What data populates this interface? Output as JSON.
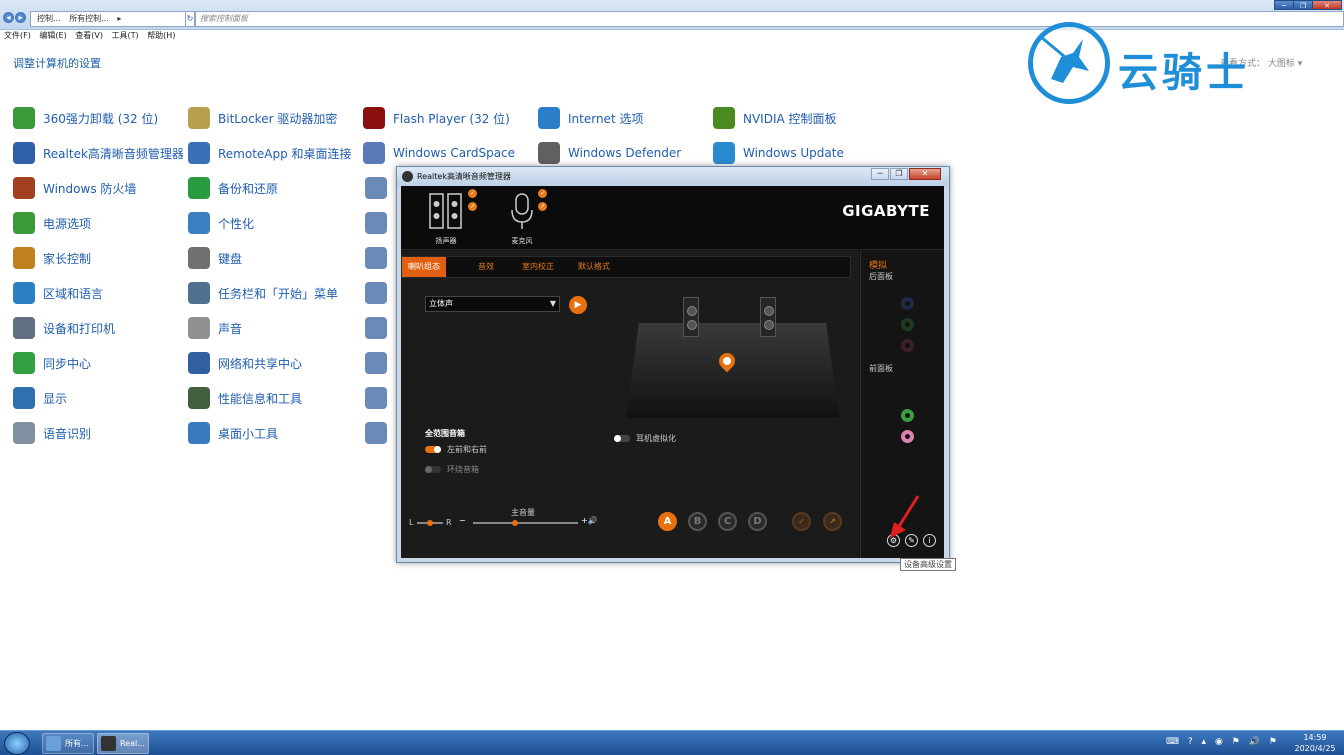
{
  "explorer": {
    "address": [
      "控制...",
      "所有控制...",
      "▸"
    ],
    "search_placeholder": "搜索控制面板",
    "menu": [
      "文件(F)",
      "编辑(E)",
      "查看(V)",
      "工具(T)",
      "帮助(H)"
    ],
    "heading": "调整计算机的设置",
    "view_options": "查看方式：  大图标 ▾",
    "window_controls": [
      "─",
      "❐",
      "✕"
    ]
  },
  "watermark": {
    "text": "云骑士"
  },
  "control_panel": {
    "items": [
      {
        "label": "360强力卸载 (32 位)",
        "icon": "uninstall-icon",
        "color": "#3a9a3a"
      },
      {
        "label": "BitLocker 驱动器加密",
        "icon": "bitlocker-key-icon",
        "color": "#b8a050"
      },
      {
        "label": "Flash Player (32 位)",
        "icon": "flash-icon",
        "color": "#8a1010"
      },
      {
        "label": "Internet 选项",
        "icon": "internet-globe-icon",
        "color": "#2a7fc8"
      },
      {
        "label": "NVIDIA 控制面板",
        "icon": "nvidia-icon",
        "color": "#4a8a20"
      },
      {
        "label": "Realtek高清晰音频管理器",
        "icon": "realtek-audio-icon",
        "color": "#2f5fa8"
      },
      {
        "label": "RemoteApp 和桌面连接",
        "icon": "remoteapp-icon",
        "color": "#3a70b8"
      },
      {
        "label": "Windows CardSpace",
        "icon": "cardspace-icon",
        "color": "#5a7ab8"
      },
      {
        "label": "Windows Defender",
        "icon": "defender-icon",
        "color": "#606060"
      },
      {
        "label": "Windows Update",
        "icon": "windows-update-icon",
        "color": "#2a8ad0"
      },
      {
        "label": "Windows 防火墙",
        "icon": "firewall-icon",
        "color": "#a04020"
      },
      {
        "label": "备份和还原",
        "icon": "backup-icon",
        "color": "#2a9a40"
      },
      {
        "label": "电源选项",
        "icon": "power-icon",
        "color": "#3a9a3a"
      },
      {
        "label": "个性化",
        "icon": "personalize-icon",
        "color": "#3a80c0"
      },
      {
        "label": "家长控制",
        "icon": "parental-control-icon",
        "color": "#c08020"
      },
      {
        "label": "键盘",
        "icon": "keyboard-icon",
        "color": "#707070"
      },
      {
        "label": "区域和语言",
        "icon": "region-globe-icon",
        "color": "#2a80c0"
      },
      {
        "label": "任务栏和「开始」菜单",
        "icon": "taskbar-icon",
        "color": "#507090"
      },
      {
        "label": "设备和打印机",
        "icon": "printer-icon",
        "color": "#607080"
      },
      {
        "label": "声音",
        "icon": "sound-icon",
        "color": "#909090"
      },
      {
        "label": "同步中心",
        "icon": "sync-icon",
        "color": "#30a040"
      },
      {
        "label": "网络和共享中心",
        "icon": "network-icon",
        "color": "#3060a0"
      },
      {
        "label": "显示",
        "icon": "display-icon",
        "color": "#3070b0"
      },
      {
        "label": "性能信息和工具",
        "icon": "performance-icon",
        "color": "#406040"
      },
      {
        "label": "语音识别",
        "icon": "microphone-icon",
        "color": "#8090a0"
      },
      {
        "label": "桌面小工具",
        "icon": "gadgets-icon",
        "color": "#3a7ac0"
      }
    ]
  },
  "realtek": {
    "title": "Realtek高清晰音频管理器",
    "brand": "GIGABYTE",
    "devices": [
      {
        "label": "扬声器",
        "icon": "speaker-icon"
      },
      {
        "label": "麦克风",
        "icon": "microphone-icon"
      }
    ],
    "tabs": [
      "喇叭组态",
      "音效",
      "室内校正",
      "默认格式"
    ],
    "speaker_config": "立体声",
    "headphone_virtualization": "耳机虚拟化",
    "fullrange_title": "全范围音箱",
    "front_lr": "左前和右前",
    "surround": "环绕音箱",
    "balance_left": "L",
    "balance_right": "R",
    "master_volume": "主音量",
    "master_volume_level": 0.4,
    "balance_level": 0.5,
    "profiles": [
      "A",
      "B",
      "C",
      "D"
    ],
    "side": {
      "analog": "模拟",
      "back_panel": "后面板",
      "front_panel": "前面板"
    },
    "tooltip": "设备高级设置",
    "colors": {
      "accent": "#e8700f",
      "jack_green": "#3aa040",
      "jack_pink": "#e080b0"
    }
  },
  "taskbar": {
    "tasks": [
      {
        "label": "所有...",
        "icon": "control-panel-icon"
      },
      {
        "label": "Real...",
        "icon": "realtek-icon"
      }
    ],
    "tray": [
      "⌨",
      "?",
      "▴",
      "◉",
      "⚑",
      "🔊",
      "⚑"
    ],
    "time": "14:59",
    "date": "2020/4/25"
  }
}
